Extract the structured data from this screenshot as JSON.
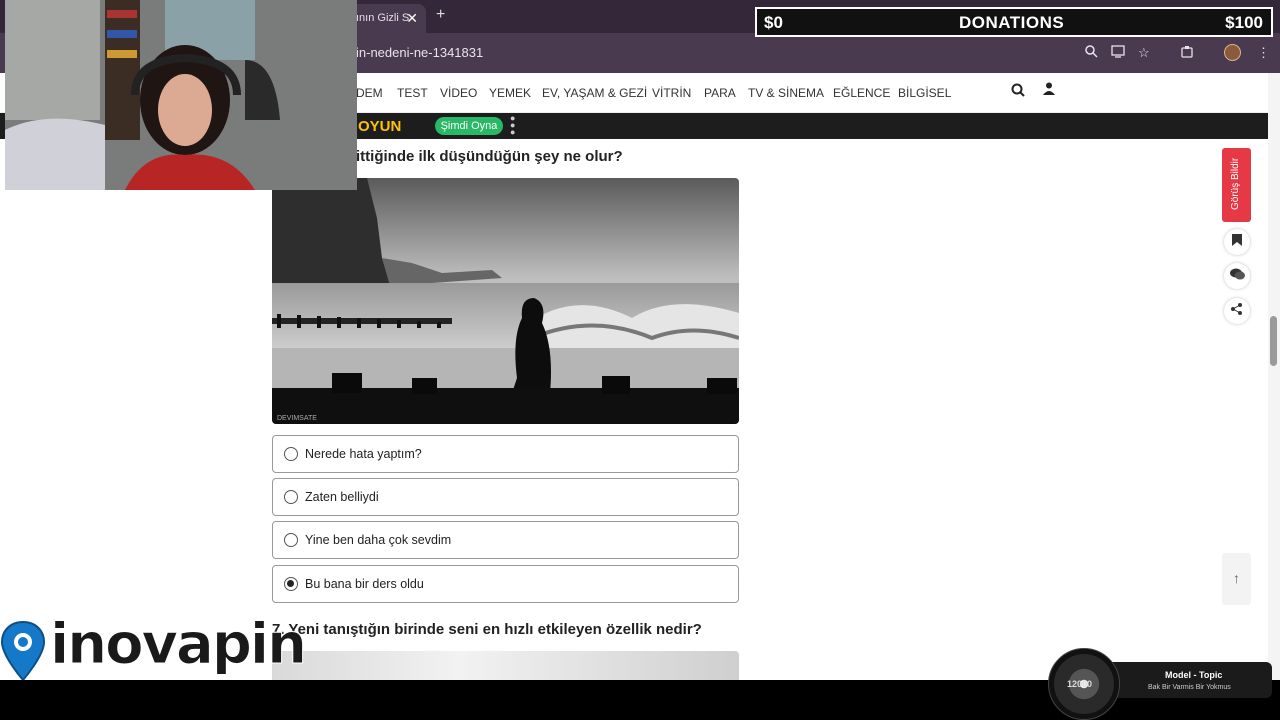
{
  "browser": {
    "tab_title": "ının Gizli S",
    "url": "in-nedeni-ne-1341831"
  },
  "donation": {
    "left_amount": "$0",
    "title": "DONATIONS",
    "right_amount": "$100"
  },
  "nav": {
    "items": [
      "DEM",
      "TEST",
      "VİDEO",
      "YEMEK",
      "EV, YAŞAM & GEZİ",
      "VİTRİN",
      "PARA",
      "TV & SİNEMA",
      "EĞLENCE",
      "BİLGİSEL"
    ]
  },
  "ad": {
    "game_text": "OYUN",
    "button_label": "Şimdi Oyna"
  },
  "quiz": {
    "q6_title": "ittiğinde ilk düşündüğün şey ne olur?",
    "photo_watermark": "DEVIMSATE",
    "options": [
      {
        "label": "Nerede hata yaptım?",
        "selected": false
      },
      {
        "label": "Zaten belliydi",
        "selected": false
      },
      {
        "label": "Yine ben daha çok sevdim",
        "selected": false
      },
      {
        "label": "Bu bana bir ders oldu",
        "selected": true
      }
    ],
    "q7_title": "7. Yeni tanıştığın birinde seni en hızlı etkileyen özellik nedir?"
  },
  "sidebar": {
    "feedback_label": "Görüş Bildir"
  },
  "overlay": {
    "logo_text": "inovapin",
    "music_title": "Model - Topic",
    "music_subtitle": "Bak Bir Varmis Bir Yokmus",
    "disc_text": "12000"
  }
}
